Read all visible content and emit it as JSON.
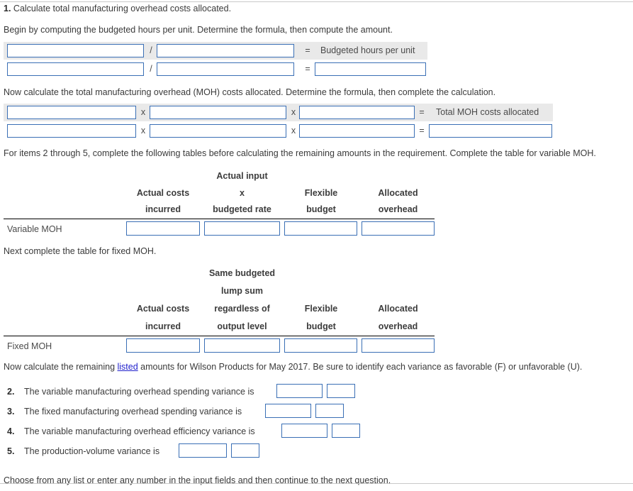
{
  "intro": {
    "q_number": "1.",
    "q_text": "Calculate total manufacturing overhead costs allocated.",
    "begin_text": "Begin by computing the budgeted hours per unit. Determine the formula, then compute the amount."
  },
  "formula_budgeted_hours": {
    "operator": "/",
    "equals": "=",
    "result_label": "Budgeted hours per unit",
    "inputs_row1": [
      "",
      ""
    ],
    "inputs_row2": [
      "",
      "",
      ""
    ]
  },
  "moh_intro": "Now calculate the total manufacturing overhead (MOH) costs allocated. Determine the formula, then complete the calculation.",
  "formula_total_moh": {
    "operator1": "x",
    "operator2": "x",
    "equals": "=",
    "result_label": "Total MOH costs allocated",
    "inputs_row1": [
      "",
      "",
      ""
    ],
    "inputs_row2": [
      "",
      "",
      "",
      ""
    ]
  },
  "items_intro": "For items 2 through 5, complete the following tables before calculating the remaining amounts in the requirement. Complete the table for variable MOH.",
  "variable_table": {
    "headers_top": [
      "",
      "Actual input",
      "",
      ""
    ],
    "headers_mid": [
      "Actual costs",
      "x",
      "Flexible",
      "Allocated"
    ],
    "headers_bot": [
      "incurred",
      "budgeted rate",
      "budget",
      "overhead"
    ],
    "row_label": "Variable MOH",
    "cells": [
      "",
      "",
      "",
      ""
    ]
  },
  "fixed_intro": "Next complete the table for fixed MOH.",
  "fixed_table": {
    "headers_line1": [
      "",
      "Same budgeted",
      "",
      ""
    ],
    "headers_line2": [
      "",
      "lump sum",
      "",
      ""
    ],
    "headers_line3": [
      "Actual costs",
      "regardless of",
      "Flexible",
      "Allocated"
    ],
    "headers_line4": [
      "incurred",
      "output level",
      "budget",
      "overhead"
    ],
    "row_label": "Fixed MOH",
    "cells": [
      "",
      "",
      "",
      ""
    ]
  },
  "remaining": {
    "text_before_link": "Now calculate the remaining ",
    "link_text": "listed",
    "text_after_link": " amounts for Wilson Products for May 2017. Be sure to identify each variance as favorable (F) or unfavorable (U)."
  },
  "variance_items": [
    {
      "num": "2.",
      "label": "The variable manufacturing overhead spending variance is",
      "amount": "",
      "flag": ""
    },
    {
      "num": "3.",
      "label": "The fixed manufacturing overhead spending variance is",
      "amount": "",
      "flag": ""
    },
    {
      "num": "4.",
      "label": "The variable manufacturing overhead efficiency variance is",
      "amount": "",
      "flag": ""
    },
    {
      "num": "5.",
      "label": "The production-volume variance is",
      "amount": "",
      "flag": ""
    }
  ],
  "footer": "Choose from any list or enter any number in the input fields and then continue to the next question."
}
